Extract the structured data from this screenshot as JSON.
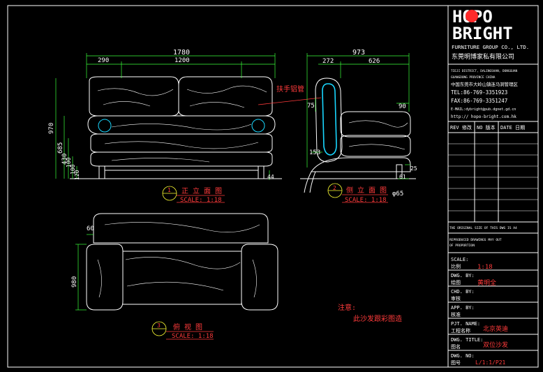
{
  "title_block": {
    "brand_line1": "HOPO",
    "brand_line2": "BRIGHT",
    "company_en": "FURNITURE GROUP CO., LTD.",
    "company_cn": "东莞明博家私有限公司",
    "address_en_1": "TIEJI DISTRICT, DALINGSHAN, DONGGUAN",
    "address_en_2": "GUANGDONG PROVINCE CHINA",
    "address_cn": "中国东莞市大岭山镇连马洞管理区",
    "tel": "TEL:86-769-3351923",
    "fax": "FAX:86-769-3351247",
    "email": "E-MAIL:dybright@pub.dgnet.gd.cn",
    "http": "http:// hopo-bright.com.hk",
    "rev_headers": [
      "REV 修改",
      "NO 版本",
      "DATE 日期"
    ],
    "original_size_note": "THE ORIGINAL SIZE OF THIS DWG IS A4",
    "reproduction_note_1": "REPRODUCED DRAWINGS MAY OUT",
    "reproduction_note_2": "OF PROPORTION",
    "fields": [
      {
        "en": "SCALE:",
        "cn": "比例",
        "value": "1:18"
      },
      {
        "en": "DWG. BY:",
        "cn": "绘图",
        "value": "黄明全"
      },
      {
        "en": "CHD. BY:",
        "cn": "审核",
        "value": ""
      },
      {
        "en": "APP. BY:",
        "cn": "核准",
        "value": ""
      },
      {
        "en": "PJT. NAME:",
        "cn": "工程名称",
        "value": "北京英迪"
      },
      {
        "en": "DWG. TITLE:",
        "cn": "图名",
        "value": "双位沙发"
      },
      {
        "en": "DWG. NO:",
        "cn": "图号",
        "value": "L/1:1/P21"
      }
    ]
  },
  "views": {
    "front": {
      "number": "1",
      "name": "正 立 面 图",
      "scale": "SCALE: 1:18"
    },
    "side": {
      "number": "2",
      "name": "侧 立 面 图",
      "scale": "SCALE: 1:18"
    },
    "plan": {
      "number": "3",
      "name": "俯 视 图",
      "scale": "SCALE: 1:18"
    }
  },
  "dimensions": {
    "front_total_width": "1780",
    "front_arm_width": "290",
    "front_seat_width": "1200",
    "front_height": "970",
    "front_h1": "685",
    "front_h2": "430",
    "front_h3": "100",
    "front_h4": "100",
    "front_h5": "120",
    "front_foot": "44",
    "side_total_depth": "973",
    "side_back_depth": "272",
    "side_seat_depth": "626",
    "side_back_thick": "75",
    "side_arm_drop": "90",
    "side_base": "153",
    "side_foot_h": "25",
    "side_foot_off": "61",
    "side_foot_dia": "φ65",
    "plan_depth": "980",
    "plan_corner": "60"
  },
  "annotations": {
    "armrest_label": "扶手铝管",
    "note_title": "注意:",
    "note_text": "此沙发跟彩图造"
  }
}
